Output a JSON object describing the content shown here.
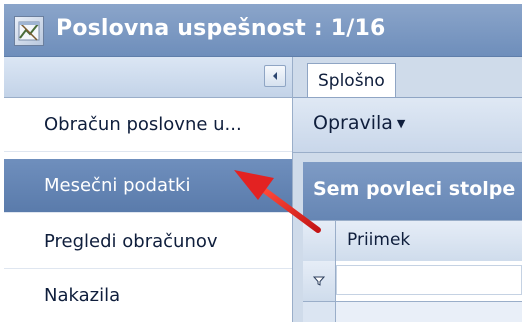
{
  "window": {
    "title": "Poslovna uspešnost : 1/16"
  },
  "nav": {
    "items": [
      {
        "label": "Obračun poslovne u...",
        "selected": false
      },
      {
        "label": "Mesečni podatki",
        "selected": true
      },
      {
        "label": "Pregledi obračunov",
        "selected": false
      },
      {
        "label": "Nakazila",
        "selected": false
      }
    ]
  },
  "tabs": [
    {
      "label": "Splošno",
      "active": true
    }
  ],
  "toolbar": {
    "tasks_label": "Opravila"
  },
  "grid": {
    "group_hint": "Sem povleci stolpe",
    "columns": [
      "Priimek"
    ]
  },
  "colors": {
    "title_bar": "#7896c2",
    "selected_item": "#6384b4",
    "annotation_arrow": "#e32222"
  },
  "icons": {
    "app": "app-icon",
    "collapse": "chevron-left-icon",
    "filter": "filter-icon",
    "dropdown": "caret-down-icon"
  }
}
